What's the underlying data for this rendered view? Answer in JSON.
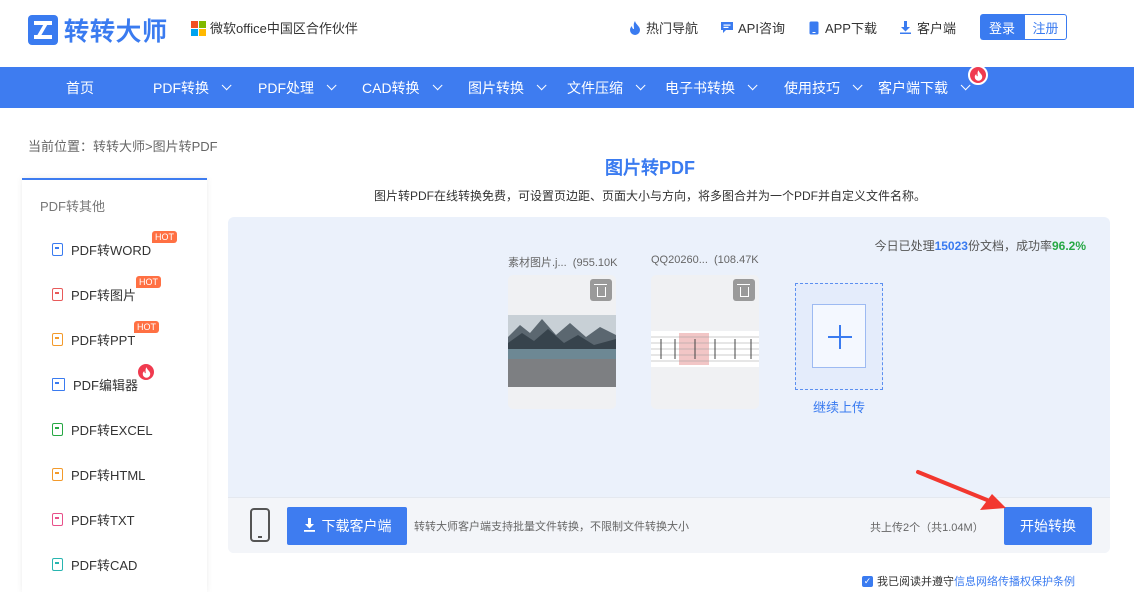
{
  "header": {
    "brand": "转转大师",
    "partner": "微软office中国区合作伙伴",
    "links": [
      {
        "label": "热门导航",
        "icon": "flame-icon"
      },
      {
        "label": "API咨询",
        "icon": "chat-icon"
      },
      {
        "label": "APP下载",
        "icon": "phone-icon"
      },
      {
        "label": "客户端",
        "icon": "download-icon"
      }
    ],
    "login": "登录",
    "register": "注册"
  },
  "nav": {
    "items": [
      {
        "label": "首页"
      },
      {
        "label": "PDF转换"
      },
      {
        "label": "PDF处理"
      },
      {
        "label": "CAD转换"
      },
      {
        "label": "图片转换"
      },
      {
        "label": "文件压缩"
      },
      {
        "label": "电子书转换"
      },
      {
        "label": "使用技巧"
      },
      {
        "label": "客户端下载"
      }
    ]
  },
  "breadcrumb": "当前位置：转转大师>图片转PDF",
  "sidebar": {
    "title": "PDF转其他",
    "items": [
      {
        "label": "PDF转WORD",
        "badge": "HOT",
        "color": "#3a7bf0"
      },
      {
        "label": "PDF转图片",
        "badge": "HOT",
        "color": "#e85a5a"
      },
      {
        "label": "PDF转PPT",
        "badge": "HOT",
        "color": "#f39a2b"
      },
      {
        "label": "PDF编辑器",
        "badge": "fire",
        "color": "#3a7bf0"
      },
      {
        "label": "PDF转EXCEL",
        "badge": "",
        "color": "#27a844"
      },
      {
        "label": "PDF转HTML",
        "badge": "",
        "color": "#f39a2b"
      },
      {
        "label": "PDF转TXT",
        "badge": "",
        "color": "#e8508a"
      },
      {
        "label": "PDF转CAD",
        "badge": "",
        "color": "#28b5b0"
      }
    ]
  },
  "main": {
    "title": "图片转PDF",
    "description": "图片转PDF在线转换免费，可设置页边距、页面大小与方向，将多图合并为一个PDF并自定义文件名称。",
    "stats": {
      "prefix": "今日已处理",
      "count": "15023",
      "middle": "份文档，成功率",
      "rate": "96.2%"
    },
    "files": [
      {
        "name": "素材图片.j...",
        "size": "(955.10K"
      },
      {
        "name": "QQ20260...",
        "size": "(108.47K"
      }
    ],
    "upload_more": "继续上传",
    "download_client": "下载客户端",
    "bottom_note": "转转大师客户端支持批量文件转换，不限制文件转换大小",
    "total": "共上传2个（共1.04M）",
    "start": "开始转换",
    "agree_text": "我已阅读并遵守",
    "agree_link": "信息网络传播权保护条例"
  },
  "colors": {
    "brand": "#3a7bf0",
    "nav": "#3e7cf0",
    "success": "#27a844",
    "hot": "#ff7043",
    "fire": "#f03a4f"
  }
}
